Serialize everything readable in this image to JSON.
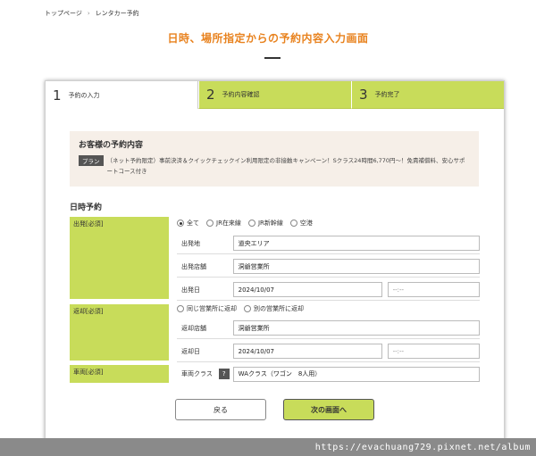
{
  "breadcrumb": {
    "home": "トップページ",
    "separator": "›",
    "current": "レンタカー予約"
  },
  "page_title": "日時、場所指定からの予約内容入力画面",
  "tabs": [
    {
      "num": "1",
      "label": "予約の入力"
    },
    {
      "num": "2",
      "label": "予約内容確認"
    },
    {
      "num": "3",
      "label": "予約完了"
    }
  ],
  "summary": {
    "title": "お客様の予約内容",
    "plan_tag": "プラン",
    "plan_text": "（ネット予約限定）事前決済＆クイックチェックイン利用限定の非接触キャンペーン！Sクラス24時間6,770円～！免責補償料、安心サポートコース付き"
  },
  "section_title": "日時予約",
  "departure": {
    "label": "出発[必須]",
    "radio": [
      "全て",
      "JR在来線",
      "JR新幹線",
      "空港"
    ],
    "region_label": "出発地",
    "region_value": "道央エリア",
    "store_label": "出発店舗",
    "store_value": "洞爺営業所",
    "date_label": "出発日",
    "date_value": "2024/10/07",
    "time_value": "--:--"
  },
  "return": {
    "label": "返却[必須]",
    "radio": [
      "同じ営業所に返却",
      "別の営業所に返却"
    ],
    "store_label": "返却店舗",
    "store_value": "洞爺営業所",
    "date_label": "返却日",
    "date_value": "2024/10/07",
    "time_value": "--:--"
  },
  "vehicle": {
    "label": "車両[必須]",
    "class_label": "車両クラス",
    "help": "?",
    "class_value": "WAクラス（ワゴン　8人用）"
  },
  "buttons": {
    "back": "戻る",
    "next": "次の画面へ"
  },
  "watermark": "https://evachuang729.pixnet.net/album",
  "colors": {
    "accent": "#e8821e",
    "green": "#c8dc5a",
    "summary_bg": "#f6efe8"
  }
}
